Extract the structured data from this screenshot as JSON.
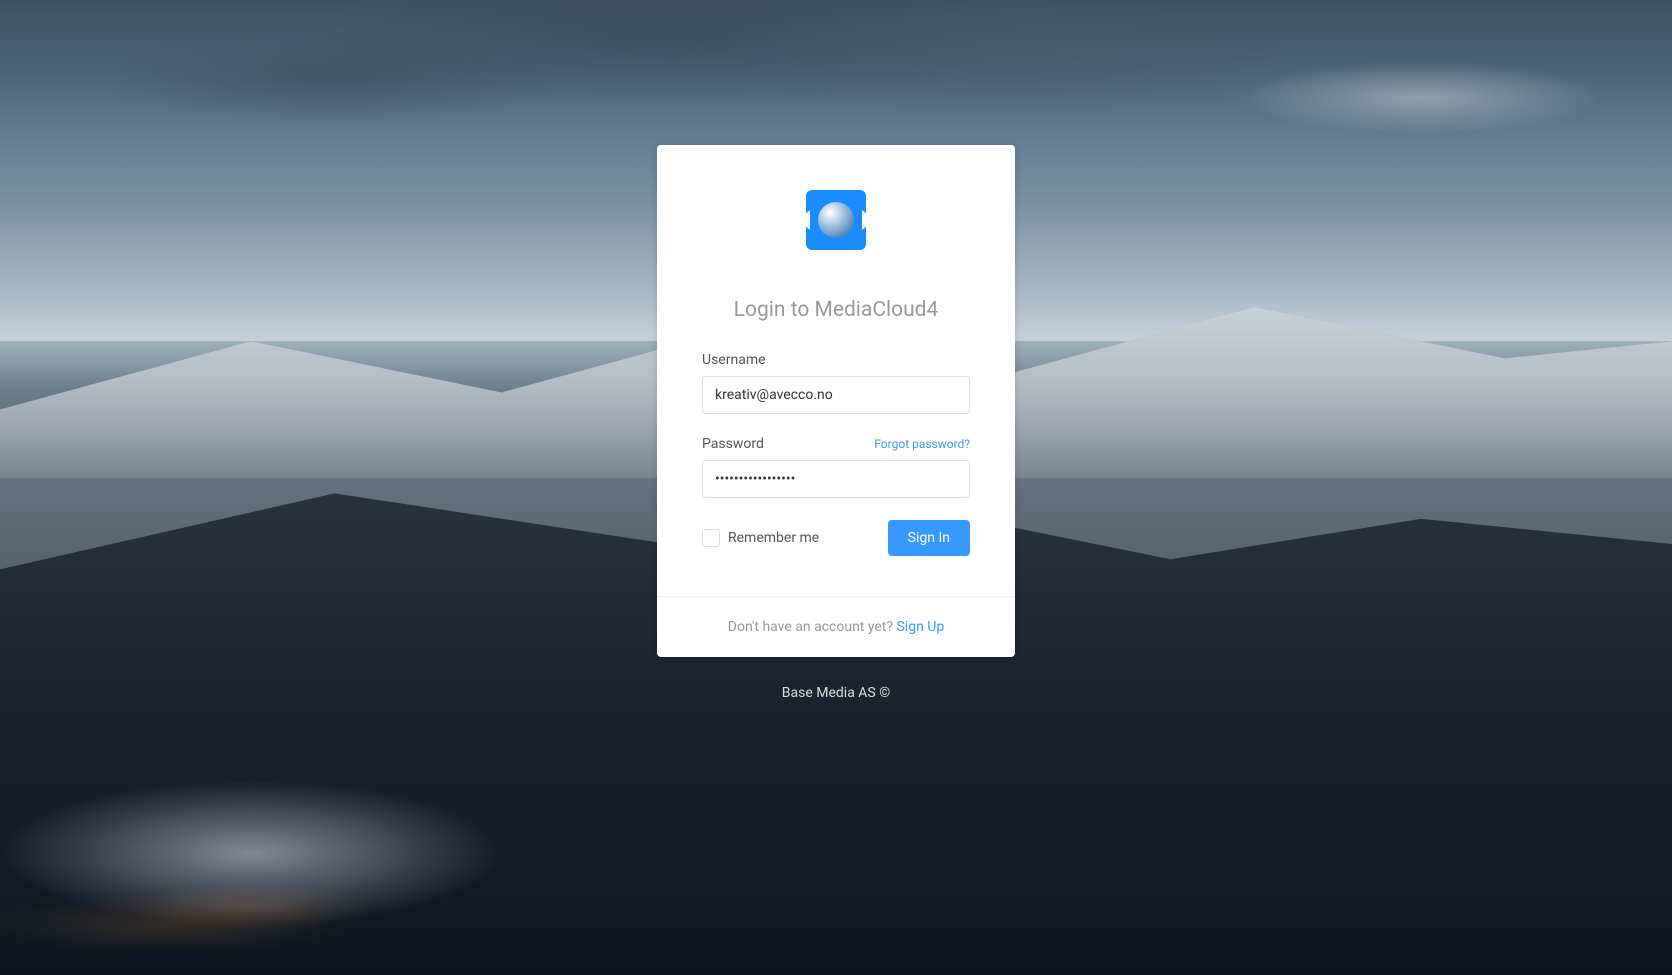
{
  "login": {
    "title": "Login to MediaCloud4",
    "username_label": "Username",
    "username_value": "kreativ@avecco.no",
    "password_label": "Password",
    "password_value": "•••••••••••••••••",
    "forgot_link": "Forgot password?",
    "remember_label": "Remember me",
    "signin_button": "Sign In",
    "signup_prompt": "Don't have an account yet? ",
    "signup_link": "Sign Up"
  },
  "footer": {
    "copyright": "Base Media AS ©"
  }
}
